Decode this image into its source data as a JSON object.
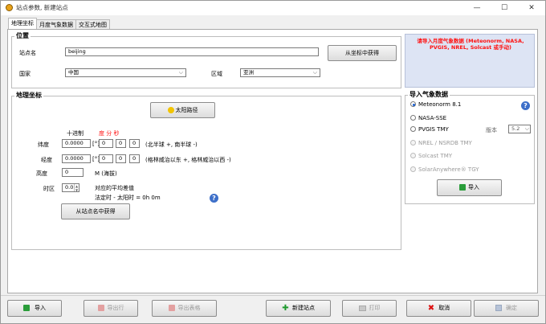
{
  "window": {
    "title": "站点参数, 新建站点",
    "min": "—",
    "max": "☐",
    "close": "✕"
  },
  "tabs": [
    {
      "label": "地理坐标"
    },
    {
      "label": "月度气象数据"
    },
    {
      "label": "交互式地图"
    }
  ],
  "location": {
    "group_title": "位置",
    "site_name_label": "站点名",
    "site_name_value": "beijing",
    "from_coords_button": "从坐标中获得",
    "country_label": "国家",
    "country_value": "中国",
    "region_label": "区域",
    "region_value": "亚洲"
  },
  "warning": {
    "text": "请导入月度气象数据 (Meteonorm, NASA, PVGIS, NREL, Solcast 或手动)"
  },
  "geo": {
    "group_title": "地理坐标",
    "sun_path_button": "太阳路径",
    "decimal_header": "十进制",
    "dms_header": "度 分 秒",
    "lat_label": "纬度",
    "lat_decimal": "0.0000",
    "lat_unit": "[°]",
    "lat_deg": "0",
    "lat_min": "0",
    "lat_sec": "0",
    "lat_hint": "(北半球 +, 南半球 -)",
    "lon_label": "经度",
    "lon_decimal": "0.0000",
    "lon_unit": "[°]",
    "lon_deg": "0",
    "lon_min": "0",
    "lon_sec": "0",
    "lon_hint": "(格林威治以东 +, 格林威治以西 -)",
    "alt_label": "高度",
    "alt_value": "0",
    "alt_unit": "M (海拔)",
    "tz_label": "时区",
    "tz_value": "0.0",
    "tz_desc": "对应的平均差值",
    "tz_calc": "法定时 - 太阳时 =  0h  0m",
    "from_name_button": "从站点名中获得"
  },
  "import": {
    "group_title": "导入气象数据",
    "options": [
      {
        "label": "Meteonorm 8.1"
      },
      {
        "label": "NASA-SSE"
      },
      {
        "label": "PVGIS TMY"
      },
      {
        "label": "NREL / NSRDB TMY"
      },
      {
        "label": "Solcast TMY"
      },
      {
        "label": "SolarAnywhere® TGY"
      }
    ],
    "version_label": "版本",
    "version_value": "5.2",
    "import_button": "导入"
  },
  "footer": {
    "import": "导入",
    "export_row": "导出行",
    "export_table": "导出表格",
    "new_site": "新建站点",
    "print": "打印",
    "cancel": "取消",
    "ok": "确定"
  }
}
